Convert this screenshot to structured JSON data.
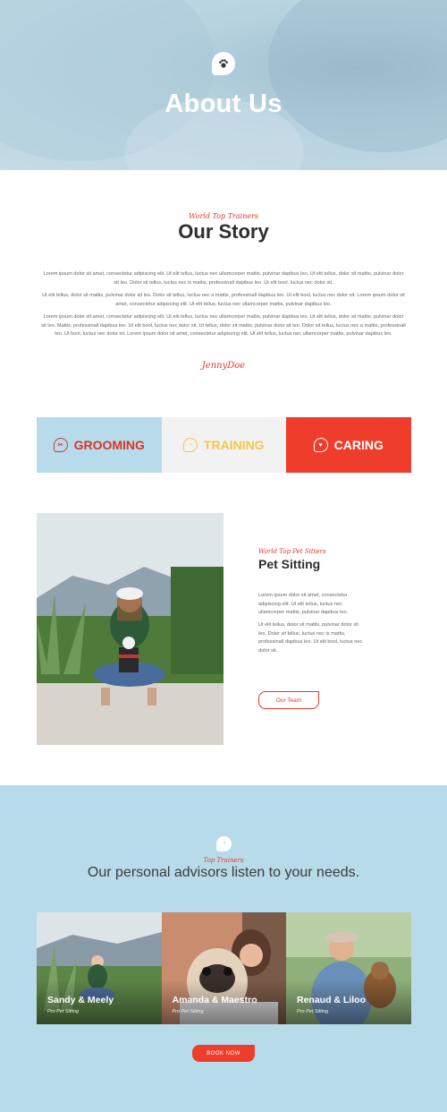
{
  "hero": {
    "title": "About Us",
    "logo_icon": "paw-icon"
  },
  "story": {
    "kicker": "World Top Trainers",
    "title": "Our Story",
    "paragraphs": [
      "Lorem ipsum dolor sit amet, consectetur adipiscing elit. Ut elit tellus, luctus nec ullamcorper mattis, pulvinar dapibus leo. Ut elit tellus, dolor sit mattis, pulvinar dolor sit leo. Dolor sit tellus, luctus nec is mattis, professinall dapibus leo. Ut elit bool, luctus nec dolor sit.",
      "Ut elit tellus, dolor sit mattis, pulvinar dolor sit leo. Dolor sit tellus, luctus nec a mattis, professinall dapibus leo. Ut elit bool, luctus nec dolor sit. Lorem ipsum dolor sit amet, consectetur adipiscing elit. Ut elit tellus, luctus nec ullamcorper mattis, pulvinar dapibus leo.",
      "Lorem ipsum dolor sit amet, consectetur adipiscing elit. Ut elit tellus, luctus nec ullamcorper mattis, pulvinar dapibus leo. Ut elit tellus, dolor sit mattis, pulvinar dolor sit leo. Mattis, professinall dapibus leo. Ut elit bool, luctus nec dolor sit. Ut tellus, dolor sit mattis, pulvinar dolor sit leo. Dolor sit tellus, luctus nec a mattis, professinall leo. Ut bool, luctus nec dolor sit. Lorem ipsum dolor sit amet, consectetur adipiscing elit. Ut elit tellus, luctus nec ullamcorper mattis, pulvinar dapibus leo."
    ],
    "signature": "JennyDoe"
  },
  "services": [
    {
      "label": "GROOMING",
      "icon": "scissors-icon",
      "color": "#d93428",
      "bg": "#b8dbeb"
    },
    {
      "label": "TRAINING",
      "icon": "whistle-icon",
      "color": "#f3c64d",
      "bg": "#f2f2f2"
    },
    {
      "label": "CARING",
      "icon": "heart-icon",
      "color": "#ffffff",
      "bg": "#ee3e2b"
    }
  ],
  "pet_sitting": {
    "kicker": "World Top Pet Sitters",
    "title": "Pet Sitting",
    "paragraphs": [
      "Lorem ipsum dolor sit amet, consectetur adipiscing elit. Ut elit tellus, luctus nec ullamcorper mattis, pulvinar dapibus leo.",
      "Ut elit tellus, dolor sit mattis, pulvinar dolor sit leo. Dolor sit tellus, luctus nec is mattis, professinall dapibus leo. Ut elit bool, luctus nec dolor sit."
    ],
    "button": "Our Team"
  },
  "advisors": {
    "kicker": "Top Trainers",
    "title": "Our personal advisors listen to your needs.",
    "cards": [
      {
        "name": "Sandy & Meely",
        "role": "Pro Pet Sitting"
      },
      {
        "name": "Amanda & Maestro",
        "role": "Pro Pet Sitting"
      },
      {
        "name": "Renaud & Liloo",
        "role": "Pro Pet Sitting"
      }
    ],
    "button": "BOOK NOW"
  },
  "colors": {
    "accent": "#ee3e2b",
    "brand_blue": "#b8dbea",
    "yellow": "#f3c64d"
  }
}
